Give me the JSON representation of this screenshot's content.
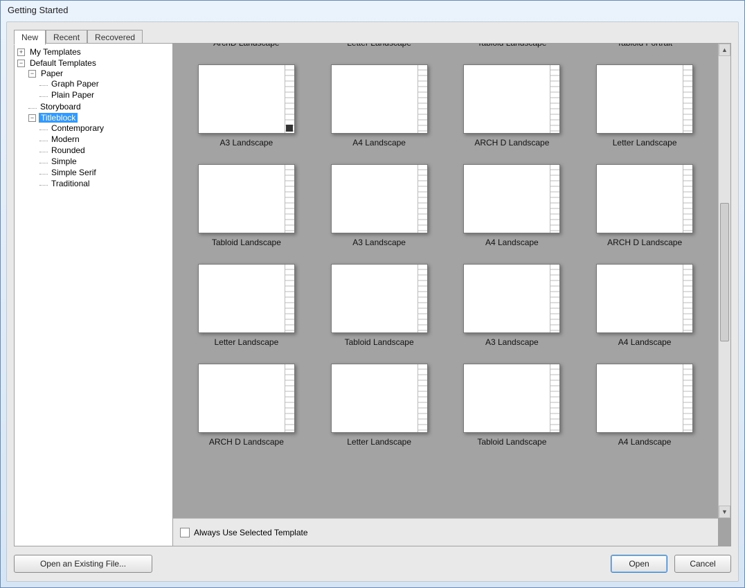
{
  "window_title": "Getting Started",
  "tabs": [
    {
      "label": "New",
      "active": true
    },
    {
      "label": "Recent",
      "active": false
    },
    {
      "label": "Recovered",
      "active": false
    }
  ],
  "tree": {
    "my_templates": "My Templates",
    "default_templates": "Default Templates",
    "paper": "Paper",
    "graph_paper": "Graph Paper",
    "plain_paper": "Plain Paper",
    "storyboard": "Storyboard",
    "titleblock": "Titleblock",
    "contemporary": "Contemporary",
    "modern": "Modern",
    "rounded": "Rounded",
    "simple": "Simple",
    "simple_serif": "Simple Serif",
    "traditional": "Traditional"
  },
  "gallery_top": [
    "ArchD Landscape",
    "Letter Landscape",
    "Tabloid Landscape",
    "Tabloid Portrait"
  ],
  "gallery": [
    "A3 Landscape",
    "A4 Landscape",
    "ARCH D Landscape",
    "Letter Landscape",
    "Tabloid Landscape",
    "A3 Landscape",
    "A4 Landscape",
    "ARCH D Landscape",
    "Letter Landscape",
    "Tabloid Landscape",
    "A3 Landscape",
    "A4 Landscape",
    "ARCH D Landscape",
    "Letter Landscape",
    "Tabloid Landscape",
    "A4 Landscape"
  ],
  "footer_checkbox": "Always Use Selected Template",
  "buttons": {
    "open_existing": "Open an Existing File...",
    "open": "Open",
    "cancel": "Cancel"
  }
}
